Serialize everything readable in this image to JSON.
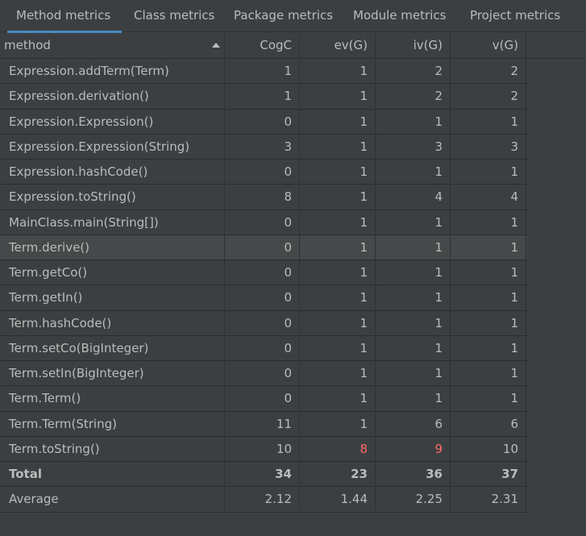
{
  "tabs": [
    {
      "label": "Method metrics",
      "active": true
    },
    {
      "label": "Class metrics",
      "active": false
    },
    {
      "label": "Package metrics",
      "active": false
    },
    {
      "label": "Module metrics",
      "active": false
    },
    {
      "label": "Project metrics",
      "active": false
    }
  ],
  "columns": {
    "method": "method",
    "cogc": "CogC",
    "ev": "ev(G)",
    "iv": "iv(G)",
    "v": "v(G)"
  },
  "sort": {
    "column": "method",
    "direction": "ascending"
  },
  "rows": [
    {
      "method": "Expression.addTerm(Term)",
      "cogc": "1",
      "ev": "1",
      "iv": "2",
      "v": "2"
    },
    {
      "method": "Expression.derivation()",
      "cogc": "1",
      "ev": "1",
      "iv": "2",
      "v": "2"
    },
    {
      "method": "Expression.Expression()",
      "cogc": "0",
      "ev": "1",
      "iv": "1",
      "v": "1"
    },
    {
      "method": "Expression.Expression(String)",
      "cogc": "3",
      "ev": "1",
      "iv": "3",
      "v": "3"
    },
    {
      "method": "Expression.hashCode()",
      "cogc": "0",
      "ev": "1",
      "iv": "1",
      "v": "1"
    },
    {
      "method": "Expression.toString()",
      "cogc": "8",
      "ev": "1",
      "iv": "4",
      "v": "4"
    },
    {
      "method": "MainClass.main(String[])",
      "cogc": "0",
      "ev": "1",
      "iv": "1",
      "v": "1"
    },
    {
      "method": "Term.derive()",
      "cogc": "0",
      "ev": "1",
      "iv": "1",
      "v": "1",
      "highlighted": true
    },
    {
      "method": "Term.getCo()",
      "cogc": "0",
      "ev": "1",
      "iv": "1",
      "v": "1"
    },
    {
      "method": "Term.getIn()",
      "cogc": "0",
      "ev": "1",
      "iv": "1",
      "v": "1"
    },
    {
      "method": "Term.hashCode()",
      "cogc": "0",
      "ev": "1",
      "iv": "1",
      "v": "1"
    },
    {
      "method": "Term.setCo(BigInteger)",
      "cogc": "0",
      "ev": "1",
      "iv": "1",
      "v": "1"
    },
    {
      "method": "Term.setIn(BigInteger)",
      "cogc": "0",
      "ev": "1",
      "iv": "1",
      "v": "1"
    },
    {
      "method": "Term.Term()",
      "cogc": "0",
      "ev": "1",
      "iv": "1",
      "v": "1"
    },
    {
      "method": "Term.Term(String)",
      "cogc": "11",
      "ev": "1",
      "iv": "6",
      "v": "6"
    },
    {
      "method": "Term.toString()",
      "cogc": "10",
      "ev": "8",
      "iv": "9",
      "v": "10",
      "ev_red": true,
      "iv_red": true
    }
  ],
  "total": {
    "method": "Total",
    "cogc": "34",
    "ev": "23",
    "iv": "36",
    "v": "37"
  },
  "average": {
    "method": "Average",
    "cogc": "2.12",
    "ev": "1.44",
    "iv": "2.25",
    "v": "2.31"
  },
  "colors": {
    "background": "#3c3f41",
    "text": "#bbbbbb",
    "accent": "#4a88c7",
    "warning_value": "#ff6b68",
    "highlight_row": "#45494a"
  }
}
